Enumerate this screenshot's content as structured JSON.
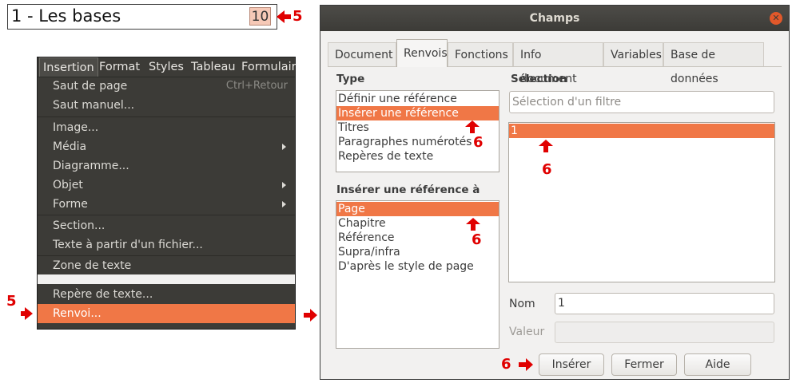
{
  "heading": {
    "text": "1 - Les bases",
    "page_number": "10"
  },
  "markers": {
    "step5": "5",
    "step6": "6"
  },
  "menu": {
    "bar": [
      "Insertion",
      "Format",
      "Styles",
      "Tableau",
      "Formulair"
    ],
    "items": [
      {
        "label": "Saut de page",
        "shortcut": "Ctrl+Retour"
      },
      {
        "label": "Saut manuel..."
      },
      {
        "label": "Image..."
      },
      {
        "label": "Média"
      },
      {
        "label": "Diagramme..."
      },
      {
        "label": "Objet"
      },
      {
        "label": "Forme"
      },
      {
        "label": "Section..."
      },
      {
        "label": "Texte à partir d'un fichier..."
      },
      {
        "label": "Zone de texte"
      },
      {
        "label": "Repère de texte..."
      },
      {
        "label": "Renvoi..."
      }
    ]
  },
  "dialog": {
    "title": "Champs",
    "tabs": [
      "Document",
      "Renvois",
      "Fonctions",
      "Info document",
      "Variables",
      "Base de données"
    ],
    "type_label": "Type",
    "type_items": [
      "Définir une référence",
      "Insérer une référence",
      "Titres",
      "Paragraphes numérotés",
      "Repères de texte"
    ],
    "insert_ref_label": "Insérer une référence à",
    "insert_ref_items": [
      "Page",
      "Chapitre",
      "Référence",
      "Supra/infra",
      "D'après le style de page"
    ],
    "selection_label": "Sélection",
    "filter_placeholder": "Sélection d'un filtre",
    "selection_items": [
      "1"
    ],
    "name_label": "Nom",
    "name_value": "1",
    "value_label": "Valeur",
    "buttons": {
      "insert": "Insérer",
      "close": "Fermer",
      "help": "Aide"
    }
  },
  "colors": {
    "highlight": "#f07746",
    "marker": "#e00000",
    "menu_bg": "#3c3b37"
  }
}
